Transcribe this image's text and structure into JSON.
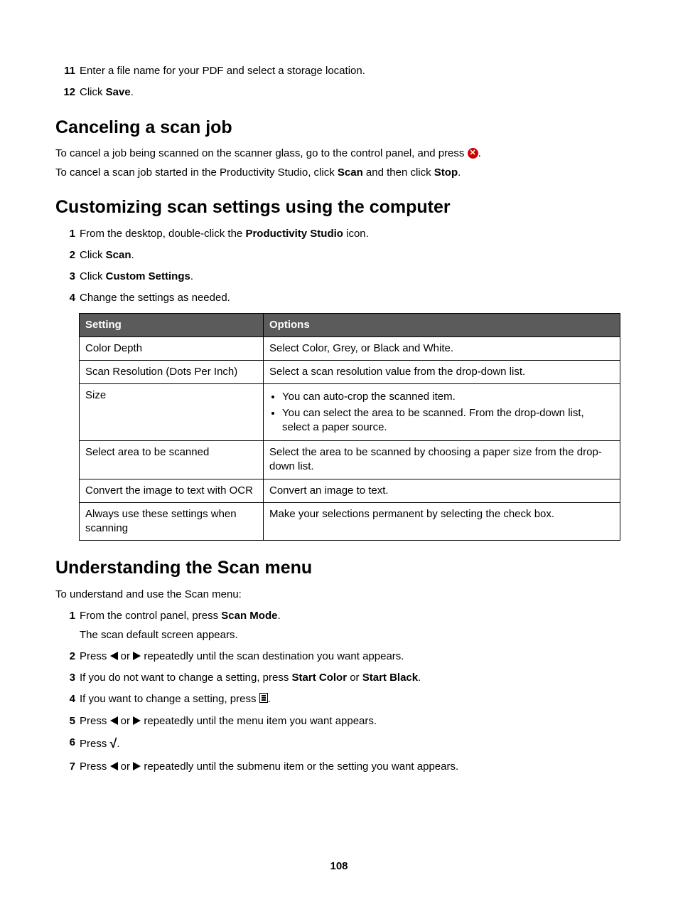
{
  "top_steps": [
    {
      "num": "11",
      "text": "Enter a file name for your PDF and select a storage location."
    },
    {
      "num": "12",
      "prefix": "Click ",
      "bold": "Save",
      "suffix": "."
    }
  ],
  "h_cancel": "Canceling a scan job",
  "cancel_p1_a": "To cancel a job being scanned on the scanner glass, go to the control panel, and press ",
  "cancel_p1_b": ".",
  "cancel_p2_a": "To cancel a scan job started in the Productivity Studio, click ",
  "cancel_p2_b1": "Scan",
  "cancel_p2_mid": " and then click ",
  "cancel_p2_b2": "Stop",
  "cancel_p2_end": ".",
  "h_custom": "Customizing scan settings using the computer",
  "custom_steps": [
    {
      "num": "1",
      "prefix": "From the desktop, double-click the ",
      "bold": "Productivity Studio",
      "suffix": " icon."
    },
    {
      "num": "2",
      "prefix": "Click ",
      "bold": "Scan",
      "suffix": "."
    },
    {
      "num": "3",
      "prefix": "Click ",
      "bold": "Custom Settings",
      "suffix": "."
    },
    {
      "num": "4",
      "text": "Change the settings as needed."
    }
  ],
  "table": {
    "h1": "Setting",
    "h2": "Options",
    "rows": [
      {
        "s": "Color Depth",
        "o": "Select Color, Grey, or Black and White."
      },
      {
        "s": "Scan Resolution (Dots Per Inch)",
        "o": "Select a scan resolution value from the drop-down list."
      },
      {
        "s": "Size",
        "bullets": [
          "You can auto-crop the scanned item.",
          "You can select the area to be scanned. From the drop-down list, select a paper source."
        ]
      },
      {
        "s": "Select area to be scanned",
        "o": "Select the area to be scanned by choosing a paper size from the drop-down list."
      },
      {
        "s": "Convert the image to text with OCR",
        "o": "Convert an image to text."
      },
      {
        "s": "Always use these settings when scanning",
        "o": "Make your selections permanent by selecting the check box."
      }
    ]
  },
  "h_understand": "Understanding the Scan menu",
  "understand_intro": "To understand and use the Scan menu:",
  "understand_steps": {
    "s1_a": "From the control panel, press ",
    "s1_b": "Scan Mode",
    "s1_c": ".",
    "s1_sub": "The scan default screen appears.",
    "s2_a": "Press ",
    "s2_mid": " or ",
    "s2_b": " repeatedly until the scan destination you want appears.",
    "s3_a": "If you do not want to change a setting, press ",
    "s3_b1": "Start Color",
    "s3_mid": " or ",
    "s3_b2": "Start Black",
    "s3_end": ".",
    "s4_a": "If you want to change a setting, press ",
    "s4_end": ".",
    "s5_a": "Press ",
    "s5_mid": " or ",
    "s5_b": " repeatedly until the menu item you want appears.",
    "s6_a": "Press ",
    "s6_end": ".",
    "s7_a": "Press ",
    "s7_mid": " or ",
    "s7_b": " repeatedly until the submenu item or the setting you want appears."
  },
  "page_number": "108"
}
